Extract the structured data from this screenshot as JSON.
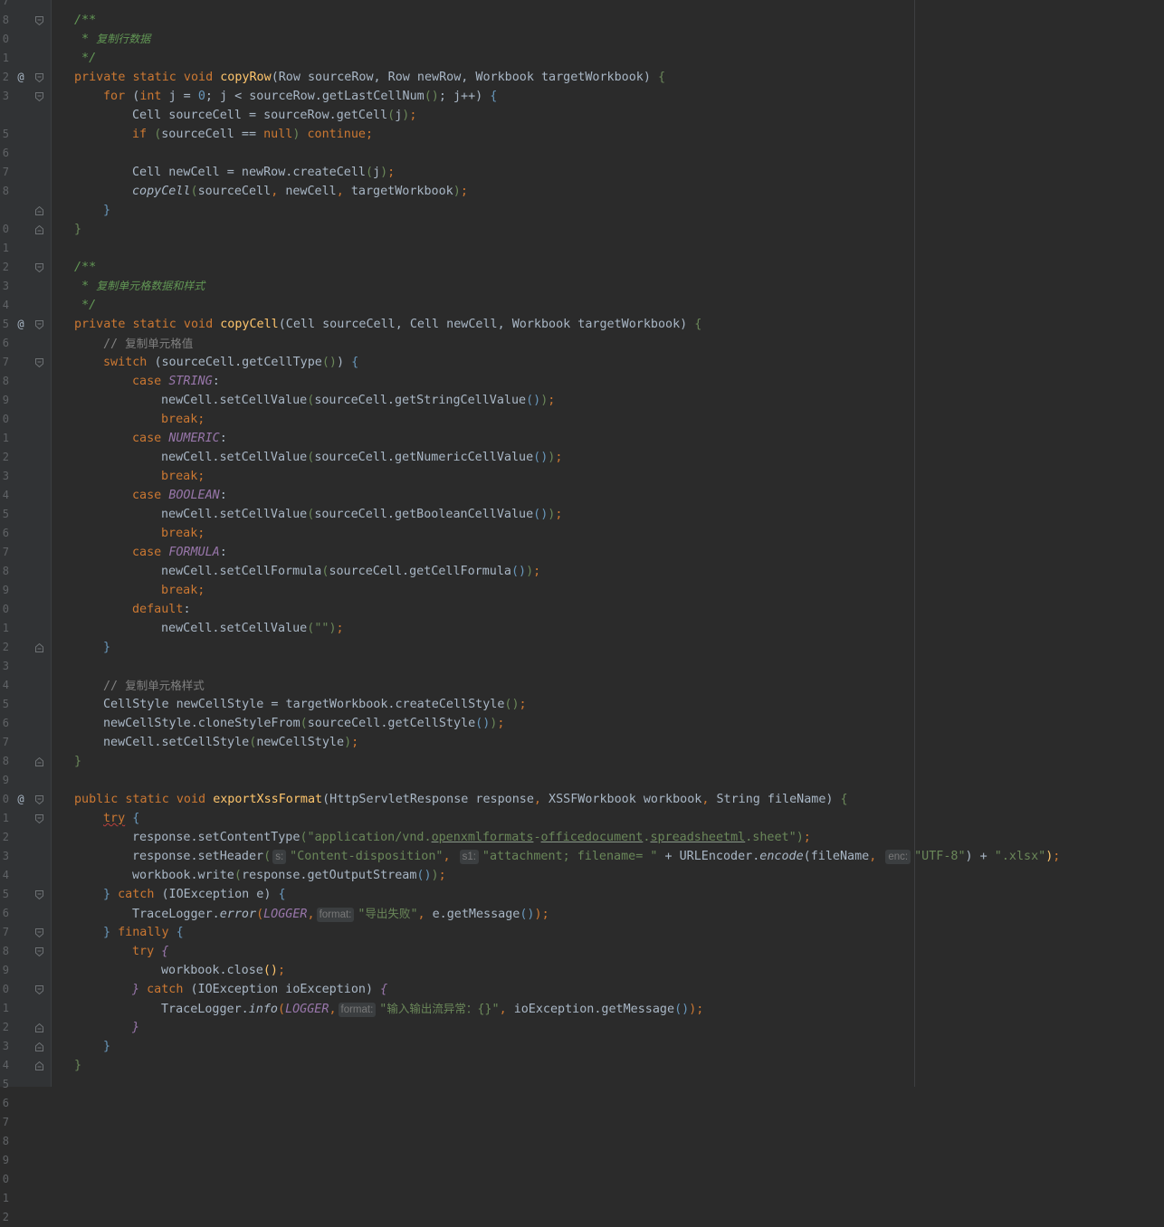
{
  "editor": {
    "line_numbers": [
      "7",
      "8",
      "0",
      "1",
      "2",
      "3",
      "",
      "5",
      "6",
      "7",
      "8",
      "",
      "0",
      "1",
      "2",
      "3",
      "4",
      "5",
      "6",
      "7",
      "8",
      "9",
      "0",
      "1",
      "2",
      "3",
      "4",
      "5",
      "6",
      "7",
      "8",
      "9",
      "0",
      "1",
      "2",
      "3",
      "4",
      "5",
      "6",
      "7",
      "8",
      "9",
      "0",
      "1",
      "2",
      "3",
      "4",
      "5",
      "6",
      "7",
      "8",
      "9",
      "0",
      "1",
      "2",
      "3",
      "4",
      "5",
      "6",
      "7",
      "8",
      "9",
      "0",
      "1",
      "2"
    ],
    "annotation_symbol": "@",
    "lines": {
      "l1": {
        "t1": "/**"
      },
      "l2": {
        "t1": " * ",
        "t2": "复制行数据"
      },
      "l3": {
        "t1": " */"
      },
      "l4": {
        "t1": "private static void ",
        "t2": "copyRow",
        "t3": "(Row sourceRow, Row newRow, Workbook targetWorkbook) ",
        "t4": "{"
      },
      "l5": {
        "t1": "for ",
        "t2": "(",
        "t3": "int ",
        "t4": "j = ",
        "t5": "0",
        "t6": "; j < sourceRow.getLastCellNum",
        "t7": "()",
        "t8": "; j++",
        "t9": ") ",
        "t10": "{"
      },
      "l6": {
        "t1": "Cell sourceCell = sourceRow.getCell",
        "t2": "(",
        "t3": "j",
        "t4": ")",
        "t5": ";"
      },
      "l7": {
        "t1": "if ",
        "t2": "(",
        "t3": "sourceCell == ",
        "t4": "null",
        "t5": ") ",
        "t6": "continue;"
      },
      "l9": {
        "t1": "Cell newCell = newRow.createCell",
        "t2": "(",
        "t3": "j",
        "t4": ")",
        "t5": ";"
      },
      "l10": {
        "t1": "copyCell",
        "t2": "(",
        "t3": "sourceCell",
        "t4": ", ",
        "t5": "newCell",
        "t6": ", ",
        "t7": "targetWorkbook",
        "t8": ")",
        "t9": ";"
      },
      "l11": {
        "t1": "}"
      },
      "l12": {
        "t1": "}"
      },
      "l14": {
        "t1": "/**"
      },
      "l15": {
        "t1": " * ",
        "t2": "复制单元格数据和样式"
      },
      "l16": {
        "t1": " */"
      },
      "l17": {
        "t1": "private static void ",
        "t2": "copyCell",
        "t3": "(Cell sourceCell, Cell newCell, Workbook targetWorkbook) ",
        "t4": "{"
      },
      "l18": {
        "t1": "// ",
        "t2": "复制单元格值"
      },
      "l19": {
        "t1": "switch ",
        "t2": "(",
        "t3": "sourceCell.getCellType",
        "t4": "()",
        "t5": ") ",
        "t6": "{"
      },
      "l20": {
        "t1": "case ",
        "t2": "STRING",
        "t3": ":"
      },
      "l21": {
        "t1": "newCell.setCellValue",
        "t2": "(",
        "t3": "sourceCell.getStringCellValue",
        "t4": "()",
        "t5": ")",
        "t6": ";"
      },
      "l22": {
        "t1": "break;"
      },
      "l23": {
        "t1": "case ",
        "t2": "NUMERIC",
        "t3": ":"
      },
      "l24": {
        "t1": "newCell.setCellValue",
        "t2": "(",
        "t3": "sourceCell.getNumericCellValue",
        "t4": "()",
        "t5": ")",
        "t6": ";"
      },
      "l25": {
        "t1": "break;"
      },
      "l26": {
        "t1": "case ",
        "t2": "BOOLEAN",
        "t3": ":"
      },
      "l27": {
        "t1": "newCell.setCellValue",
        "t2": "(",
        "t3": "sourceCell.getBooleanCellValue",
        "t4": "()",
        "t5": ")",
        "t6": ";"
      },
      "l28": {
        "t1": "break;"
      },
      "l29": {
        "t1": "case ",
        "t2": "FORMULA",
        "t3": ":"
      },
      "l30": {
        "t1": "newCell.setCellFormula",
        "t2": "(",
        "t3": "sourceCell.getCellFormula",
        "t4": "()",
        "t5": ")",
        "t6": ";"
      },
      "l31": {
        "t1": "break;"
      },
      "l32": {
        "t1": "default",
        "t2": ":"
      },
      "l33": {
        "t1": "newCell.setCellValue",
        "t2": "(",
        "t3": "\"\"",
        "t4": ")",
        "t5": ";"
      },
      "l34": {
        "t1": "}"
      },
      "l36": {
        "t1": "// ",
        "t2": "复制单元格样式"
      },
      "l37": {
        "t1": "CellStyle newCellStyle = targetWorkbook.createCellStyle",
        "t2": "()",
        "t3": ";"
      },
      "l38": {
        "t1": "newCellStyle.cloneStyleFrom",
        "t2": "(",
        "t3": "sourceCell.getCellStyle",
        "t4": "()",
        "t5": ")",
        "t6": ";"
      },
      "l39": {
        "t1": "newCell.setCellStyle",
        "t2": "(",
        "t3": "newCellStyle",
        "t4": ")",
        "t5": ";"
      },
      "l40": {
        "t1": "}"
      },
      "l42": {
        "t1": "public static void ",
        "t2": "exportXssFormat",
        "t3": "(HttpServletResponse response",
        "t4": ", ",
        "t5": "XSSFWorkbook workbook",
        "t6": ", ",
        "t7": "String fileName",
        "t8": ") ",
        "t9": "{"
      },
      "l43": {
        "t1": "try",
        "t2": " {"
      },
      "l44": {
        "t1": "response.setContentType",
        "t2": "(",
        "t3": "\"application/vnd.",
        "t4": "openxmlformats",
        "t5": "-",
        "t6": "officedocument",
        "t7": ".",
        "t8": "spreadsheetml",
        "t9": ".sheet\"",
        "t10": ")",
        "t11": ";"
      },
      "l45": {
        "t1": "response.setHeader",
        "t2": "(",
        "h1": "s:",
        "t3": "\"Content-disposition\"",
        "t4": ", ",
        "h2": "s1:",
        "t5": "\"attachment; filename= \" ",
        "t6": "+ URLEncoder.",
        "t7": "encode",
        "t8": "(",
        "t9": "fileName",
        "t10": ", ",
        "h3": "enc:",
        "t11": "\"UTF-8\"",
        "t12": ") + ",
        "t13": "\".xlsx\"",
        "t14": ")",
        "t15": ";"
      },
      "l46": {
        "t1": "workbook.write",
        "t2": "(",
        "t3": "response.getOutputStream",
        "t4": "()",
        "t5": ")",
        "t6": ";"
      },
      "l47": {
        "t1": "} ",
        "t2": "catch ",
        "t3": "(IOException e) ",
        "t4": "{"
      },
      "l48": {
        "t1": "TraceLogger.",
        "t2": "error",
        "t3": "(",
        "t4": "LOGGER",
        "t5": ",",
        "h1": "format:",
        "t6": "\"",
        "t7": "导出失败",
        "t8": "\"",
        "t9": ", ",
        "t10": "e.getMessage",
        "t11": "()",
        "t12": ")",
        "t13": ";"
      },
      "l49": {
        "t1": "} ",
        "t2": "finally ",
        "t3": "{"
      },
      "l50": {
        "t1": "try ",
        "t2": "{"
      },
      "l51": {
        "t1": "workbook.close",
        "t2": "()",
        "t3": ";"
      },
      "l52": {
        "t1": "} ",
        "t2": "catch ",
        "t3": "(IOException ioException) ",
        "t4": "{"
      },
      "l53": {
        "t1": "TraceLogger.",
        "t2": "info",
        "t3": "(",
        "t4": "LOGGER",
        "t5": ",",
        "h1": "format:",
        "t6": "\"",
        "t7": "输入输出流异常：",
        "t8": "{}\"",
        "t9": ", ",
        "t10": "ioException.getMessage",
        "t11": "()",
        "t12": ")",
        "t13": ";"
      },
      "l54": {
        "t1": "}"
      },
      "l55": {
        "t1": "}"
      },
      "l56": {
        "t1": "}"
      }
    }
  }
}
